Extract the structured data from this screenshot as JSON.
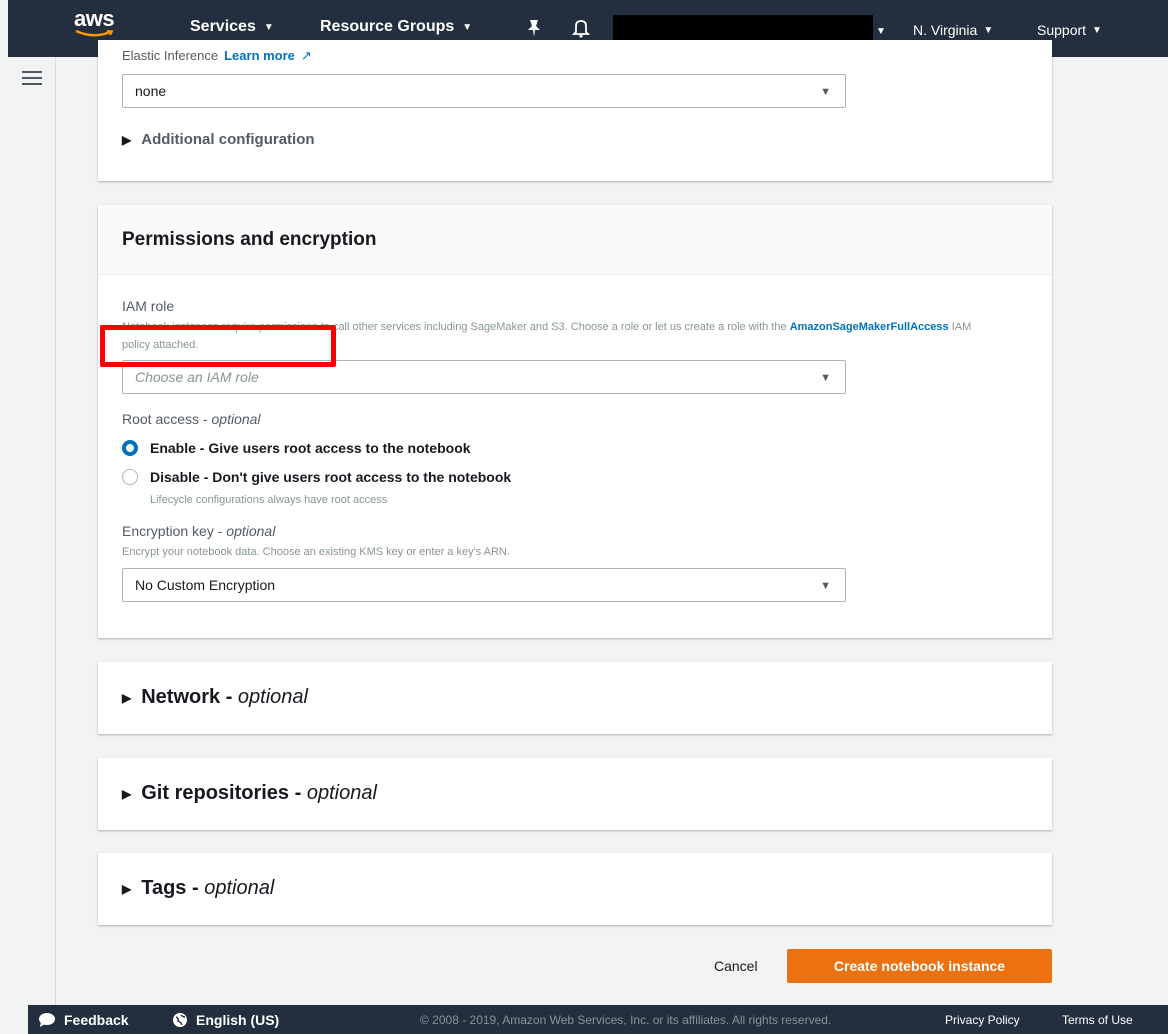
{
  "topnav": {
    "logo": "aws",
    "services": "Services",
    "resource_groups": "Resource Groups",
    "region": "N. Virginia",
    "support": "Support"
  },
  "panel_top": {
    "elastic_inference_label": "Elastic Inference",
    "learn_more": "Learn more",
    "elastic_inference_value": "none",
    "additional_configuration": "Additional configuration"
  },
  "permissions": {
    "title": "Permissions and encryption",
    "iam_role_label": "IAM role",
    "iam_desc_start": "Notebook instances require permissions to call other services including SageMaker and S3. Choose a role or let us create a role with the",
    "iam_desc_link": "AmazonSageMakerFullAccess",
    "iam_desc_end": "IAM policy attached.",
    "iam_placeholder": "Choose an IAM role",
    "root_label": "Root access",
    "optional": "optional",
    "enable_option": "Enable - Give users root access to the notebook",
    "disable_option": "Disable - Don't give users root access to the notebook",
    "disable_note": "Lifecycle configurations always have root access",
    "encryption_label": "Encryption key",
    "encryption_desc": "Encrypt your notebook data. Choose an existing KMS key or enter a key's ARN.",
    "encryption_value": "No Custom Encryption"
  },
  "sections": {
    "network": "Network",
    "git": "Git repositories",
    "tags": "Tags",
    "optional": "optional"
  },
  "actions": {
    "cancel": "Cancel",
    "create": "Create notebook instance"
  },
  "footer": {
    "feedback": "Feedback",
    "language": "English (US)",
    "copyright": "© 2008 - 2019, Amazon Web Services, Inc. or its affiliates. All rights reserved.",
    "privacy": "Privacy Policy",
    "terms": "Terms of Use"
  }
}
